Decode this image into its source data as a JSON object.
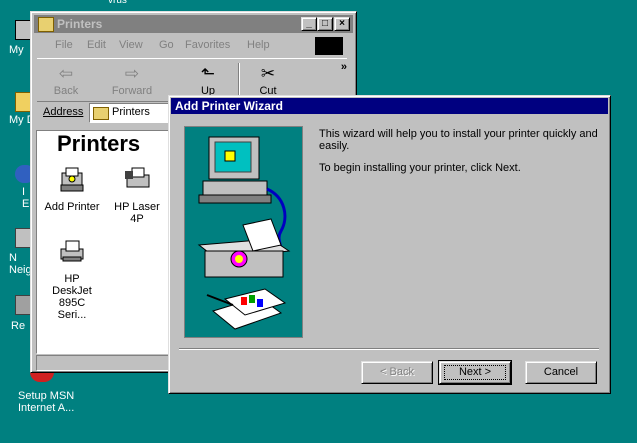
{
  "desktop": {
    "icon_labels": [
      "My",
      "My D",
      "I E",
      "N Neig",
      "Re"
    ],
    "setup_msn_line1": "Setup MSN",
    "setup_msn_line2": "Internet A...",
    "top_hint": "vrus"
  },
  "explorer": {
    "title": "Printers",
    "menu": [
      "File",
      "Edit",
      "View",
      "Go",
      "Favorites",
      "Help"
    ],
    "toolbar": {
      "back": "Back",
      "forward": "Forward",
      "up": "Up",
      "cut": "Cut",
      "more": "»"
    },
    "address_label": "Address",
    "address_value": "Printers",
    "heading": "Printers",
    "items": [
      {
        "label": "Add Printer",
        "icon": "add-printer-icon"
      },
      {
        "label": "HP Laser 4P",
        "icon": "printer-icon"
      },
      {
        "label": "HP DeskJet 895C Seri...",
        "icon": "printer-icon"
      }
    ]
  },
  "wizard": {
    "title": "Add Printer Wizard",
    "intro": "This wizard will help you to install your printer quickly and easily.",
    "instruction": "To begin installing your printer, click Next.",
    "back_label": "< Back",
    "next_label": "Next >",
    "cancel_label": "Cancel"
  },
  "colors": {
    "desktop": "#008080",
    "face": "#c0c0c0",
    "title_active": "#000080",
    "title_inactive": "#808080"
  }
}
